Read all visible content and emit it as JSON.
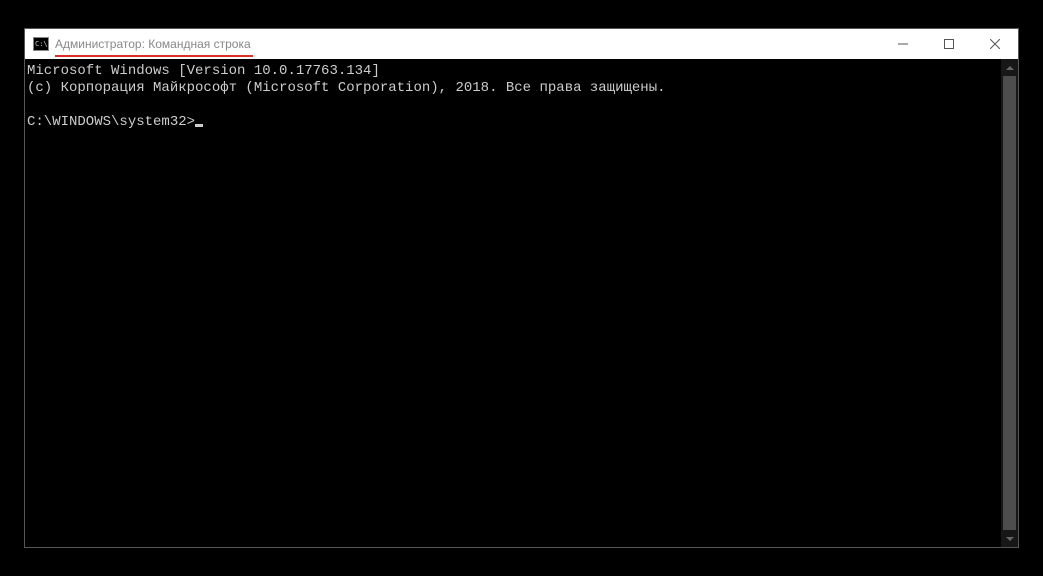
{
  "window": {
    "title": "Администратор: Командная строка"
  },
  "console": {
    "line1": "Microsoft Windows [Version 10.0.17763.134]",
    "line2": "(c) Корпорация Майкрософт (Microsoft Corporation), 2018. Все права защищены.",
    "prompt": "C:\\WINDOWS\\system32>"
  }
}
